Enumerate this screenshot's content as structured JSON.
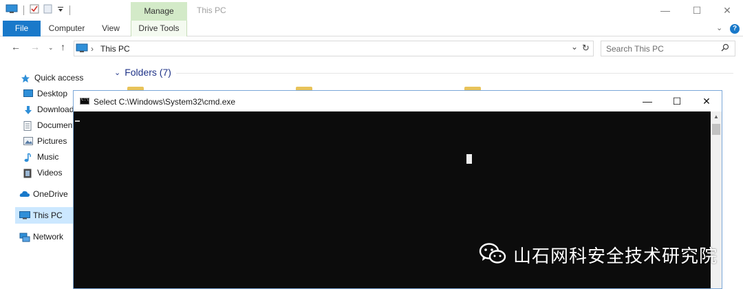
{
  "explorer": {
    "title": "This PC",
    "context_tab": "Manage",
    "window_controls": {
      "minimize": "—",
      "maximize": "☐",
      "close": "✕"
    }
  },
  "ribbon": {
    "tabs": [
      {
        "label": "File"
      },
      {
        "label": "Computer"
      },
      {
        "label": "View"
      },
      {
        "label": "Drive Tools"
      }
    ],
    "help": "?"
  },
  "address_bar": {
    "path": "This PC",
    "separator": "›",
    "search_placeholder": "Search This PC"
  },
  "nav_pane": {
    "items": [
      {
        "label": "Quick access",
        "icon": "star-icon"
      },
      {
        "label": "Desktop",
        "icon": "desktop-icon"
      },
      {
        "label": "Downloads",
        "icon": "download-arrow-icon"
      },
      {
        "label": "Documents",
        "icon": "document-icon"
      },
      {
        "label": "Pictures",
        "icon": "pictures-icon"
      },
      {
        "label": "Music",
        "icon": "music-note-icon"
      },
      {
        "label": "Videos",
        "icon": "film-icon"
      },
      {
        "label": "OneDrive",
        "icon": "cloud-icon"
      },
      {
        "label": "This PC",
        "icon": "computer-icon"
      },
      {
        "label": "Network",
        "icon": "network-icon"
      }
    ],
    "selected": "This PC"
  },
  "content": {
    "section_title": "Folders (7)"
  },
  "cmd": {
    "title": "Select C:\\Windows\\System32\\cmd.exe",
    "background": "#0c0c0c"
  },
  "watermark": {
    "text": "山石网科安全技术研究院",
    "icon": "wechat-icon"
  },
  "colors": {
    "accent": "#1979ca",
    "manage_tab": "#d3eac8",
    "selection": "#cce8ff",
    "folders_heading": "#1e3287"
  }
}
